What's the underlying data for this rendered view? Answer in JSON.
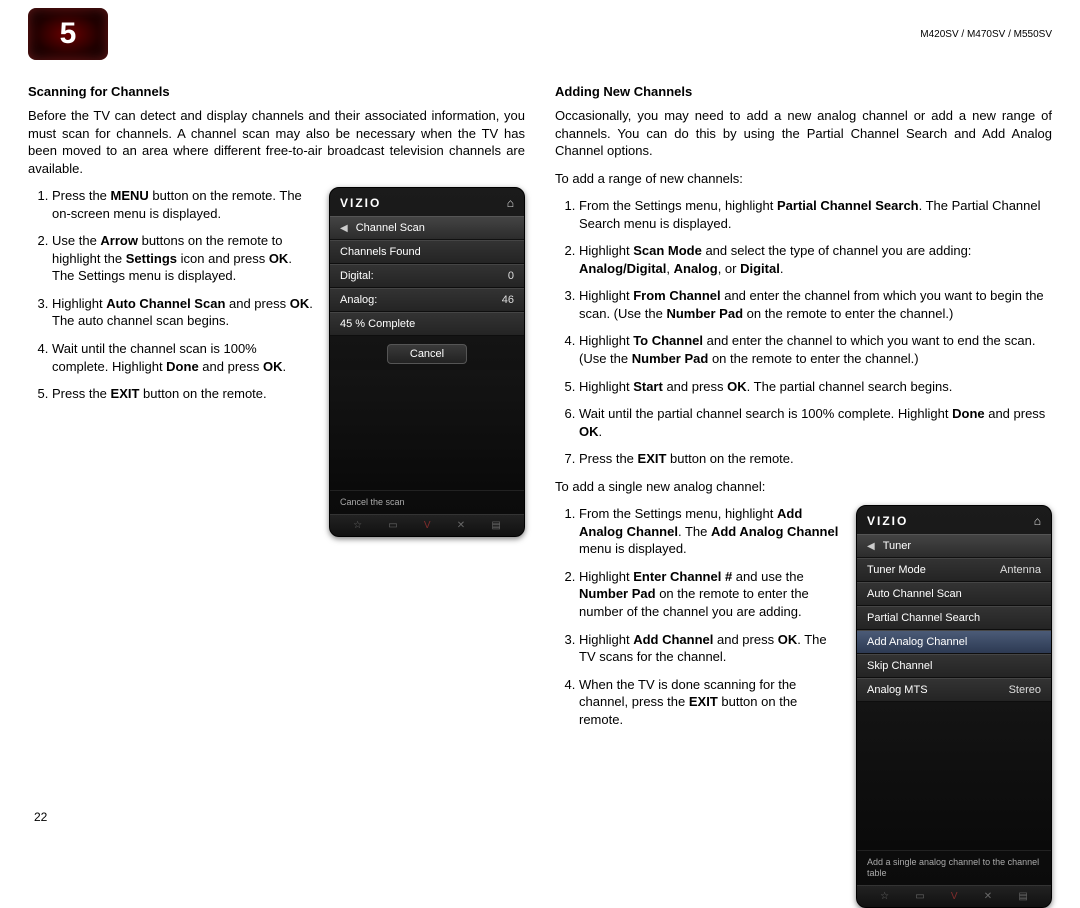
{
  "header": {
    "chapter": "5",
    "models": "M420SV / M470SV / M550SV"
  },
  "page_number": "22",
  "left": {
    "title": "Scanning for Channels",
    "intro": "Before the TV can detect and display channels and their associated information, you must scan for channels. A channel scan may also be necessary when the TV has been moved to an area where different free-to-air broadcast television channels are available.",
    "steps": [
      "Press the <b>MENU</b> button on the remote. The on-screen menu is displayed.",
      "Use the <b>Arrow</b> buttons on the remote to highlight the <b>Settings</b> icon and press <b>OK</b>. The Settings menu is displayed.",
      "Highlight <b>Auto Channel Scan</b> and press <b>OK</b>. The auto channel scan begins.",
      "Wait until the channel scan is 100% complete. Highlight <b>Done</b> and press <b>OK</b>.",
      "Press the <b>EXIT</b> button on the remote."
    ],
    "osd": {
      "logo": "VIZIO",
      "title": "Channel Scan",
      "rows": [
        {
          "label": "Channels Found",
          "value": ""
        },
        {
          "label": "Digital:",
          "value": "0"
        },
        {
          "label": "Analog:",
          "value": "46"
        },
        {
          "label": "45 % Complete",
          "value": ""
        }
      ],
      "button": "Cancel",
      "hint": "Cancel the scan"
    }
  },
  "right": {
    "title": "Adding New Channels",
    "intro": "Occasionally, you may need to add a new analog channel or add a new range of channels. You can do this by using the Partial Channel Search and Add Analog Channel options.",
    "sub1": "To add a range of new channels:",
    "steps1": [
      "From the Settings menu, highlight <b>Partial Channel Search</b>. The Partial Channel Search menu is displayed.",
      "Highlight <b>Scan Mode</b> and select the type of channel you are adding: <b>Analog/Digital</b>, <b>Analog</b>, or <b>Digital</b>.",
      "Highlight <b>From Channel</b> and enter the channel from which you want to begin the scan. (Use the <b>Number Pad</b> on the remote to enter the channel.)",
      "Highlight <b>To Channel</b> and enter the channel to which you want to end the scan. (Use the <b>Number Pad</b> on the remote to enter the channel.)",
      "Highlight <b>Start</b> and press <b>OK</b>. The partial channel search begins.",
      "Wait until the partial channel search is 100% complete. Highlight <b>Done</b> and press <b>OK</b>.",
      "Press the <b>EXIT</b> button on the remote."
    ],
    "sub2": "To add a single new analog channel:",
    "steps2": [
      "From the Settings menu, highlight <b>Add Analog Channel</b>. The <b>Add Analog Channel</b> menu is displayed.",
      "Highlight <b>Enter Channel #</b> and use the <b>Number Pad</b> on the remote to enter the number of the channel you are adding.",
      "Highlight <b>Add Channel</b> and press <b>OK</b>. The TV scans for the channel.",
      "When the TV is done scanning for the channel, press the <b>EXIT</b> button on the remote."
    ],
    "osd": {
      "logo": "VIZIO",
      "title": "Tuner",
      "rows": [
        {
          "label": "Tuner Mode",
          "value": "Antenna",
          "selected": false
        },
        {
          "label": "Auto Channel Scan",
          "value": "",
          "selected": false
        },
        {
          "label": "Partial Channel Search",
          "value": "",
          "selected": false
        },
        {
          "label": "Add Analog Channel",
          "value": "",
          "selected": true
        },
        {
          "label": "Skip Channel",
          "value": "",
          "selected": false
        },
        {
          "label": "Analog MTS",
          "value": "Stereo",
          "selected": false
        }
      ],
      "hint": "Add a single analog channel to the channel table"
    }
  }
}
